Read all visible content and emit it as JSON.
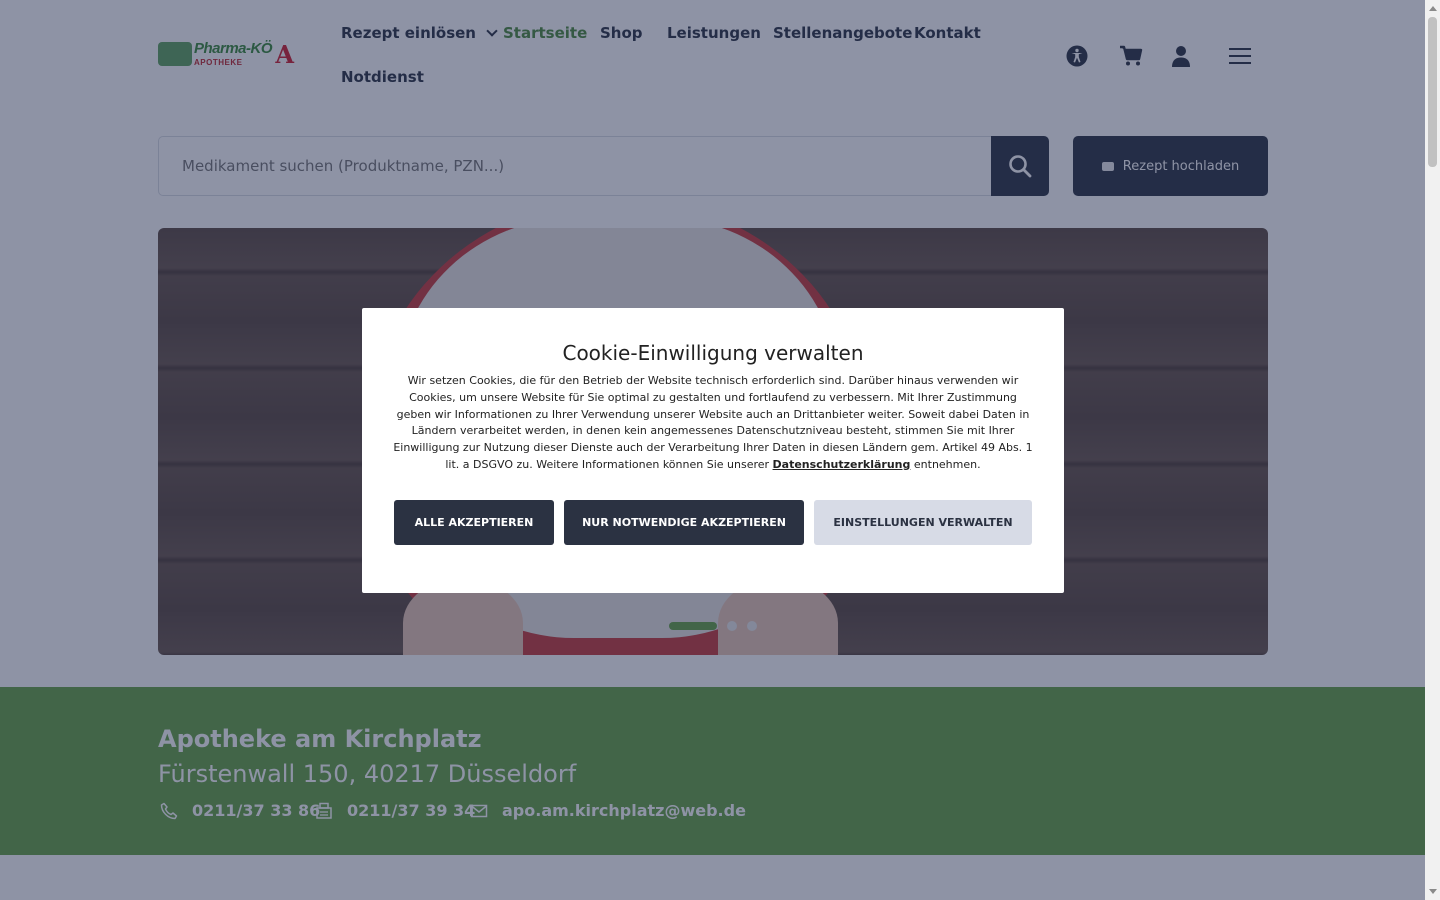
{
  "header": {
    "logo": {
      "brand_top": "Pharma-KÖ",
      "brand_bottom": "APOTHEKE"
    },
    "nav": [
      {
        "label": "Rezept einlösen",
        "dropdown": true
      },
      {
        "label": "Startseite",
        "active": true
      },
      {
        "label": "Shop"
      },
      {
        "label": "Leistungen"
      },
      {
        "label": "Stellenangebote"
      },
      {
        "label": "Kontakt"
      },
      {
        "label": "Notdienst"
      }
    ],
    "icons": [
      "accessibility-icon",
      "cart-icon",
      "user-icon",
      "menu-icon"
    ]
  },
  "search": {
    "placeholder": "Medikament suchen (Produktname, PZN...)",
    "upload_label": "Rezept hochladen"
  },
  "hero": {
    "slides": 3,
    "active_slide": 1
  },
  "info": {
    "name": "Apotheke am Kirchplatz",
    "address": "Fürstenwall 150, 40217 Düsseldorf",
    "phone": "0211/37 33 86",
    "fax": "0211/37 39 34",
    "email": "apo.am.kirchplatz@web.de"
  },
  "cookie": {
    "title": "Cookie-Einwilligung verwalten",
    "text": "Wir setzen Cookies, die für den Betrieb der Website technisch erforderlich sind. Darüber hinaus verwenden wir Cookies, um unsere Website für Sie optimal zu gestalten und fortlaufend zu verbessern. Mit Ihrer Zustimmung geben wir Informationen zu Ihrer Verwendung unserer Website auch an Drittanbieter weiter. Soweit dabei Daten in Ländern verarbeitet werden, in denen kein angemessenes Datenschutzniveau besteht, stimmen Sie mit Ihrer Einwilligung zur Nutzung dieser Dienste auch der Verarbeitung Ihrer Daten in diesen Ländern gem. Artikel 49 Abs. 1 lit. a DSGVO zu. Weitere Informationen können Sie unserer",
    "link": "Datenschutzerklärung",
    "text_end": "entnehmen.",
    "accept_all": "ALLE AKZEPTIEREN",
    "accept_necessary": "NUR NOTWENDIGE AKZEPTIEREN",
    "manage": "EINSTELLUNGEN VERWALTEN"
  },
  "colors": {
    "primary": "#2b3242",
    "accent_green": "#66a344",
    "active_nav": "#4d8a3d"
  }
}
